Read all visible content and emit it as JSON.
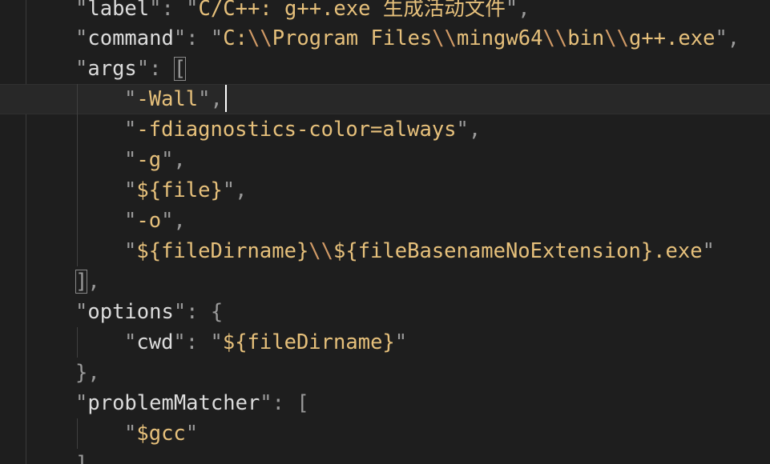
{
  "lines": {
    "label_key": "label",
    "label_val": "C/C++: g++.exe 生成活动文件",
    "command_key": "command",
    "command_val_1": "C:",
    "command_esc_1": "\\\\",
    "command_val_2": "Program Files",
    "command_esc_2": "\\\\",
    "command_val_3": "mingw64",
    "command_esc_3": "\\\\",
    "command_val_4": "bin",
    "command_esc_4": "\\\\",
    "command_val_5": "g++.exe",
    "args_key": "args",
    "args_open": "[",
    "arg_wall": "-Wall",
    "arg_fdiag": "-fdiagnostics-color=always",
    "arg_g": "-g",
    "arg_file": "${file}",
    "arg_o": "-o",
    "arg_out_1": "${fileDirname}",
    "arg_out_esc": "\\\\",
    "arg_out_2": "${fileBasenameNoExtension}.exe",
    "args_close": "]",
    "options_key": "options",
    "cwd_key": "cwd",
    "cwd_val": "${fileDirname}",
    "problem_key": "problemMatcher",
    "problem_val": "$gcc"
  },
  "colors": {
    "background": "#1e1e1e",
    "string": "#e6c07b",
    "escape": "#d19a66",
    "key": "#dcdcdc",
    "punctuation": "#9a9a9a",
    "current_line": "#282828"
  }
}
